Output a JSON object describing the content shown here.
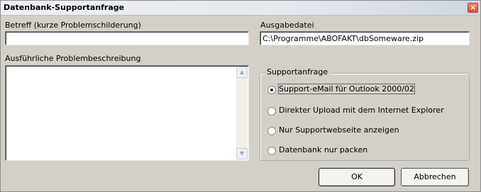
{
  "window": {
    "title": "Datenbank-Supportanfrage",
    "close_glyph": "×"
  },
  "subject": {
    "label": "Betreff (kurze Problemschilderung)",
    "value": ""
  },
  "output_file": {
    "label": "Ausgabedatei",
    "value": "C:\\Programme\\ABOFAKT\\dbSomeware.zip"
  },
  "description": {
    "label": "Ausführliche Problembeschreibung",
    "value": ""
  },
  "support": {
    "group_label": "Supportanfrage",
    "options": [
      {
        "label": "Support-eMail für Outlook 2000/02",
        "selected": true
      },
      {
        "label": "Direkter Upload mit dem Internet Explorer",
        "selected": false
      },
      {
        "label": "Nur Supportwebseite anzeigen",
        "selected": false
      },
      {
        "label": "Datenbank nur packen",
        "selected": false
      }
    ]
  },
  "buttons": {
    "ok": "OK",
    "cancel": "Abbrechen"
  },
  "icons": {
    "scroll_up": "▲",
    "scroll_down": "▼"
  }
}
